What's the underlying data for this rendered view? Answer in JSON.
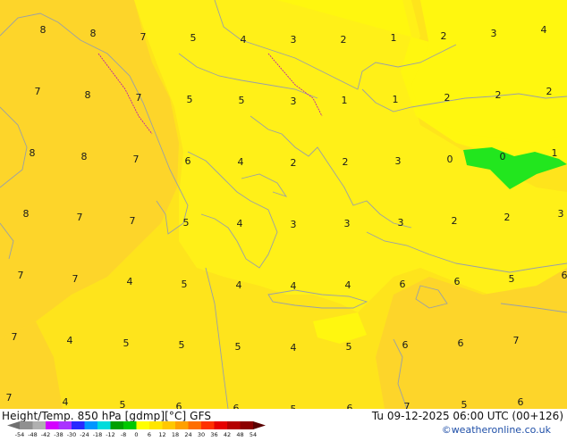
{
  "map": {
    "values": [
      "8",
      "8",
      "7",
      "5",
      "4",
      "3",
      "2",
      "1",
      "2",
      "3",
      "4",
      "7",
      "8",
      "7",
      "5",
      "5",
      "3",
      "1",
      "1",
      "2",
      "2",
      "2",
      "8",
      "8",
      "7",
      "6",
      "4",
      "2",
      "2",
      "3",
      "0",
      "0",
      "1",
      "8",
      "7",
      "7",
      "5",
      "4",
      "3",
      "3",
      "3",
      "2",
      "2",
      "3",
      "7",
      "7",
      "4",
      "5",
      "4",
      "4",
      "4",
      "6",
      "6",
      "5",
      "6",
      "7",
      "4",
      "5",
      "5",
      "5",
      "4",
      "5",
      "6",
      "6",
      "7",
      "7",
      "4",
      "5",
      "6",
      "6",
      "5",
      "6",
      "7",
      "5",
      "6"
    ]
  },
  "footer": {
    "title": "Height/Temp. 850 hPa [gdmp][°C] GFS",
    "datetime": "Tu 09-12-2025 06:00 UTC (00+126)",
    "credit": "©weatheronline.co.uk"
  },
  "legend": {
    "labels": [
      "-54",
      "-48",
      "-42",
      "-38",
      "-30",
      "-24",
      "-18",
      "-12",
      "-8",
      "0",
      "6",
      "12",
      "18",
      "24",
      "30",
      "36",
      "42",
      "48",
      "54"
    ],
    "colors": [
      "#909090",
      "#b0b0b0",
      "#d400ff",
      "#aa33ff",
      "#2828ff",
      "#0096ff",
      "#00dcdc",
      "#00a000",
      "#00c800",
      "#ffff00",
      "#ffe600",
      "#ffc800",
      "#ffa000",
      "#ff6e00",
      "#ff3200",
      "#e60000",
      "#b40000",
      "#8c0000"
    ]
  }
}
